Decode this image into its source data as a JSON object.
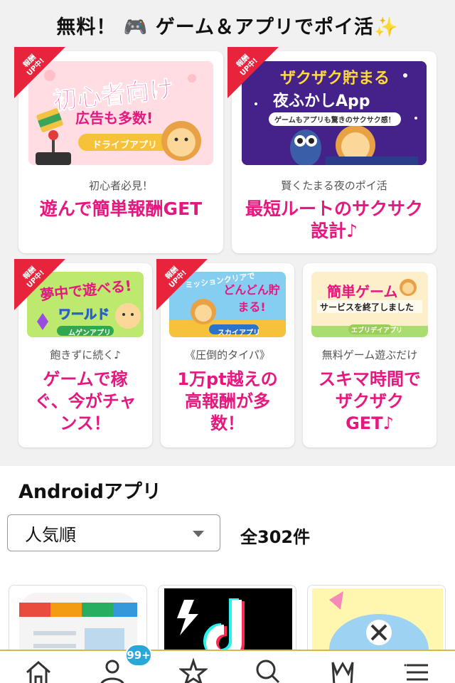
{
  "header": {
    "title": "無料！ 🎮 ゲーム＆アプリでポイ活✨"
  },
  "featured_large": [
    {
      "ribbon": "報酬\nUP中!",
      "banner_lines": [
        "初心者向け",
        "広告も多数!",
        "ドライブアプリ"
      ],
      "subtitle": "初心者必見！",
      "title": "遊んで簡単報酬GET"
    },
    {
      "ribbon": "報酬\nUP中!",
      "banner_lines": [
        "ザクザク貯まる",
        "夜ふかしApp",
        "ゲームもアプリも驚きのサクサク感！"
      ],
      "subtitle": "賢くたまる夜のポイ活",
      "title": "最短ルートのサクサク設計♪"
    }
  ],
  "featured_small": [
    {
      "ribbon": "報酬\nUP中!",
      "banner_lines": [
        "夢中で遊べる!",
        "ワールド",
        "ムゲンアプリ"
      ],
      "subtitle": "飽きずに続く♪",
      "title": "ゲームで稼ぐ、今がチャンス！"
    },
    {
      "ribbon": "報酬\nUP中!",
      "banner_lines": [
        "ミッションクリアで",
        "どんどん貯まる!",
        "スカイアプリ"
      ],
      "subtitle": "《圧倒的タイパ》",
      "title": "1万pt越えの高報酬が多数！"
    },
    {
      "ribbon": "",
      "banner_lines": [
        "簡単ゲーム",
        "サービスを終了しました",
        "エブリデイアプリ"
      ],
      "subtitle": "無料ゲーム遊ぶだけ",
      "title": "スキマ時間でザクザクGET♪"
    }
  ],
  "android_section": {
    "title": "Androidアプリ",
    "sort_selected": "人気順",
    "count": "全302件"
  },
  "tabbar": {
    "badge": "99+",
    "tabs": [
      "home-icon",
      "user-icon",
      "star-icon",
      "search-icon",
      "crown-icon",
      "menu-icon"
    ]
  },
  "colors": {
    "accent_pink": "#e6177e",
    "ribbon_red": "#e8243c",
    "badge_blue": "#29a8d8"
  }
}
